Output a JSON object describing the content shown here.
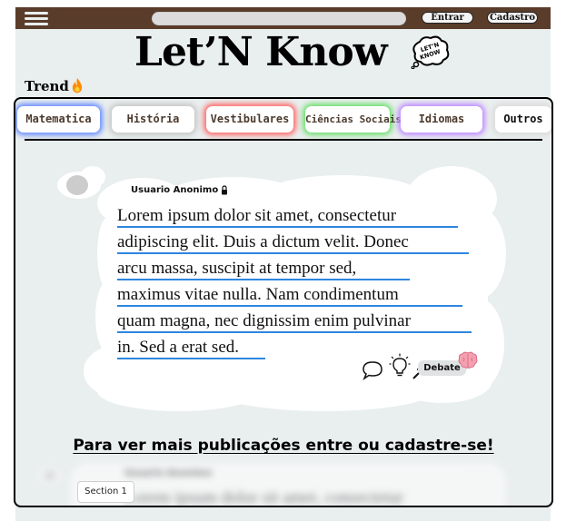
{
  "header": {
    "search_placeholder": "",
    "login_label": "Entrar",
    "signup_label": "Cadastro"
  },
  "logo": {
    "title": "Let’N Know",
    "bubble_text": "LET’N KNOW"
  },
  "trend": {
    "label": "Trend"
  },
  "categories": [
    {
      "label": "Matematica",
      "glow": "#6a8dff"
    },
    {
      "label": "História",
      "glow": "#c9c9c9"
    },
    {
      "label": "Vestibulares",
      "glow": "#ff6b6b"
    },
    {
      "label": "Ciências Sociais",
      "glow": "#6fe06f"
    },
    {
      "label": "Idiomas",
      "glow": "#c08cff"
    },
    {
      "label": "Outros",
      "glow": "#dcdcdc"
    }
  ],
  "post": {
    "author": "Usuario Anonimo",
    "lines": [
      "Lorem ipsum dolor sit amet, consectetur",
      "adipiscing elit. Duis a dictum velit. Donec",
      "arcu massa, suscipit at tempor sed,",
      "maximus vitae nulla. Nam condimentum",
      "quam magna, nec dignissim enim pulvinar",
      "in. Sed a erat sed."
    ],
    "debate_label": "Debate"
  },
  "cta": {
    "text": "Para ver mais publicações entre ou cadastre-se!"
  },
  "blurred_preview": {
    "author": "Usuario Anonimo",
    "first_line": "Lorem ipsum dolor sit amet, consectetur"
  },
  "section_chip": {
    "label": "Section 1"
  },
  "colors": {
    "topbar": "#5a3c2a",
    "page_bg": "#e9eeee",
    "underline": "#2e86de"
  }
}
